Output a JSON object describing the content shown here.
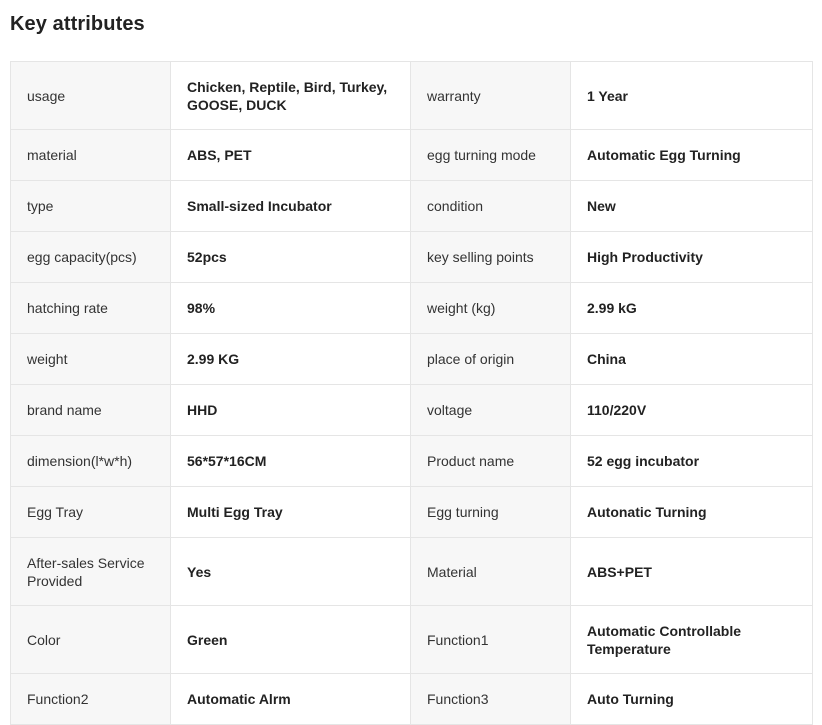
{
  "section": {
    "title": "Key attributes"
  },
  "attributes": [
    {
      "k1": "usage",
      "v1": "Chicken, Reptile, Bird, Turkey, GOOSE, DUCK",
      "k2": "warranty",
      "v2": "1 Year"
    },
    {
      "k1": "material",
      "v1": "ABS, PET",
      "k2": "egg turning mode",
      "v2": "Automatic Egg Turning"
    },
    {
      "k1": "type",
      "v1": "Small-sized Incubator",
      "k2": "condition",
      "v2": "New"
    },
    {
      "k1": "egg capacity(pcs)",
      "v1": "52pcs",
      "k2": "key selling points",
      "v2": "High Productivity"
    },
    {
      "k1": "hatching rate",
      "v1": "98%",
      "k2": "weight (kg)",
      "v2": "2.99 kG"
    },
    {
      "k1": "weight",
      "v1": "2.99 KG",
      "k2": "place of origin",
      "v2": "China"
    },
    {
      "k1": "brand name",
      "v1": "HHD",
      "k2": "voltage",
      "v2": "110/220V"
    },
    {
      "k1": "dimension(l*w*h)",
      "v1": "56*57*16CM",
      "k2": "Product name",
      "v2": "52 egg incubator"
    },
    {
      "k1": "Egg Tray",
      "v1": "Multi Egg Tray",
      "k2": "Egg turning",
      "v2": "Autonatic Turning"
    },
    {
      "k1": "After-sales Service Provided",
      "v1": "Yes",
      "k2": "Material",
      "v2": "ABS+PET"
    },
    {
      "k1": "Color",
      "v1": "Green",
      "k2": "Function1",
      "v2": "Automatic Controllable Temperature"
    },
    {
      "k1": "Function2",
      "v1": "Automatic Alrm",
      "k2": "Function3",
      "v2": "Auto Turning"
    }
  ]
}
